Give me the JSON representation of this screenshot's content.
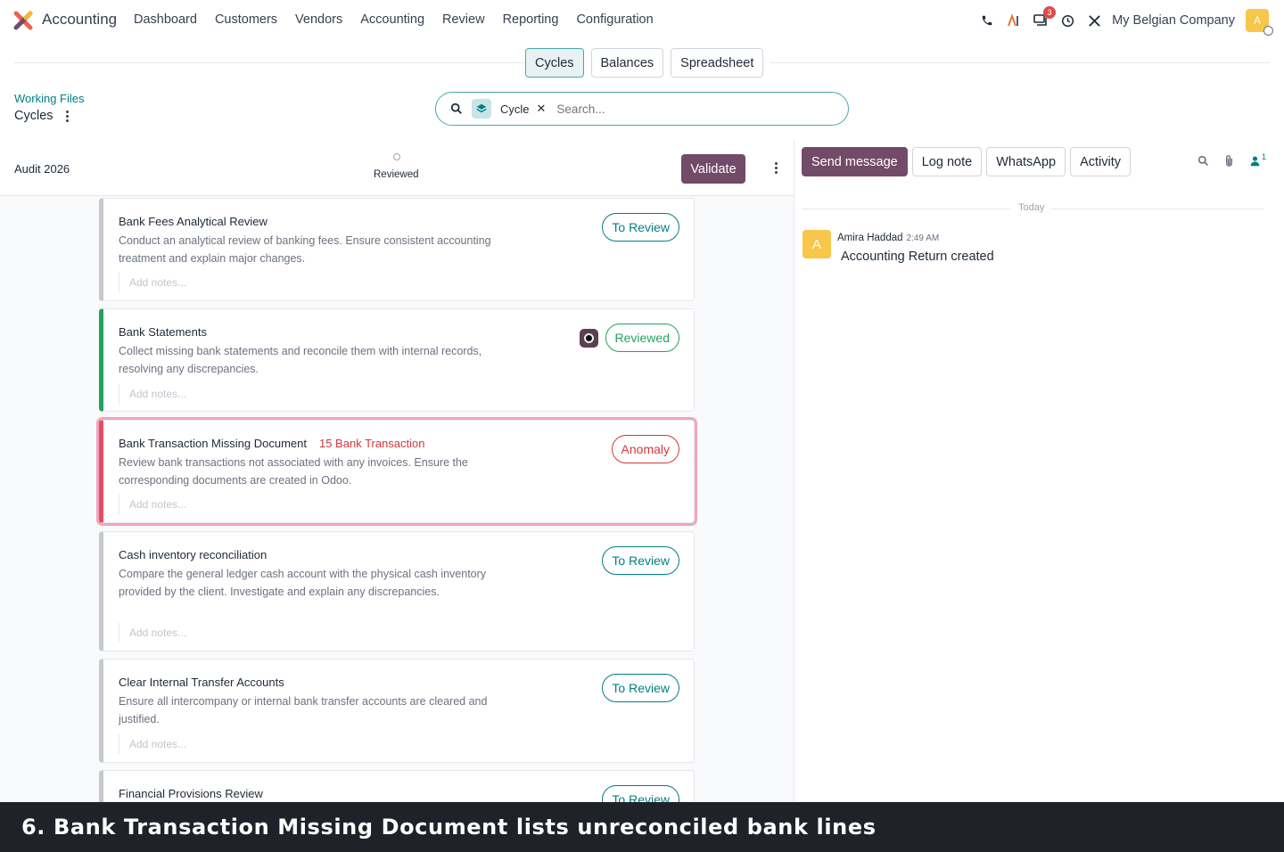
{
  "app": {
    "name": "Accounting"
  },
  "menu": [
    "Dashboard",
    "Customers",
    "Vendors",
    "Accounting",
    "Review",
    "Reporting",
    "Configuration"
  ],
  "systray": {
    "messages_count": "3",
    "company": "My Belgian Company",
    "avatar_letter": "A"
  },
  "view_tabs": [
    "Cycles",
    "Balances",
    "Spreadsheet"
  ],
  "breadcrumb": {
    "parent": "Working Files",
    "current": "Cycles"
  },
  "search": {
    "facet": "Cycle",
    "placeholder": "Search..."
  },
  "cycle": {
    "name": "Audit 2026",
    "status": "Reviewed",
    "validate_label": "Validate"
  },
  "tasks": [
    {
      "title": "Bank Fees Analytical Review",
      "link": "",
      "description": "Conduct an analytical review of banking fees. Ensure consistent accounting treatment and explain major changes.",
      "notes_placeholder": "Add notes...",
      "status": "To Review"
    },
    {
      "title": "Bank Statements",
      "link": "",
      "description": "Collect missing bank statements and reconcile them with internal records, resolving any discrepancies.",
      "notes_placeholder": "Add notes...",
      "status": "Reviewed"
    },
    {
      "title": "Bank Transaction Missing Document",
      "link": "15 Bank Transaction",
      "description": "Review bank transactions not associated with any invoices. Ensure the corresponding documents are created in Odoo.",
      "notes_placeholder": "Add notes...",
      "status": "Anomaly"
    },
    {
      "title": "Cash inventory reconciliation",
      "link": "",
      "description": "Compare the general ledger cash account with the physical cash inventory provided by the client. Investigate and explain any discrepancies.",
      "notes_placeholder": "Add notes...",
      "status": "To Review"
    },
    {
      "title": "Clear Internal Transfer Accounts",
      "link": "",
      "description": "Ensure all intercompany or internal bank transfer accounts are cleared and justified.",
      "notes_placeholder": "Add notes...",
      "status": "To Review"
    },
    {
      "title": "Financial Provisions Review",
      "link": "",
      "description": "",
      "notes_placeholder": "",
      "status": "To Review"
    }
  ],
  "chatter": {
    "buttons": [
      "Send message",
      "Log note",
      "WhatsApp",
      "Activity"
    ],
    "followers_count": "1",
    "date_separator": "Today",
    "message": {
      "avatar_letter": "A",
      "author": "Amira Haddad",
      "time": "2:49 AM",
      "body": "Accounting Return created"
    }
  },
  "caption": "6. Bank Transaction Missing Document lists unreconciled bank lines",
  "colors": {
    "brand": "#714b67",
    "accent": "#017e84",
    "success": "#22a45d",
    "danger": "#d0383a"
  }
}
